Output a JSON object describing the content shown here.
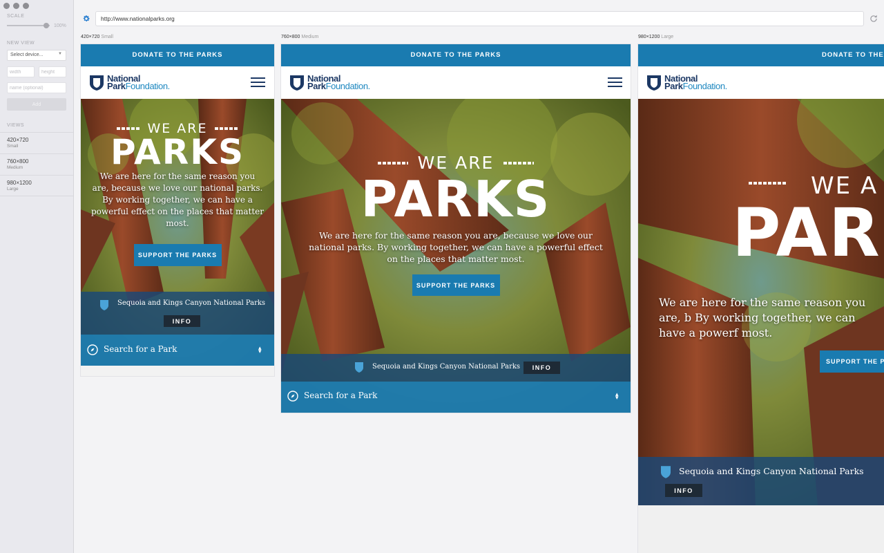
{
  "sidebar": {
    "scale_label": "SCALE",
    "scale_value": "100%",
    "new_view_label": "NEW VIEW",
    "device_select": "Select device...",
    "width_placeholder": "width",
    "height_placeholder": "height",
    "name_placeholder": "name (optional)",
    "add_label": "Add",
    "views_label": "VIEWS",
    "views": [
      {
        "size": "420×720",
        "name": "Small"
      },
      {
        "size": "760×800",
        "name": "Medium"
      },
      {
        "size": "980×1200",
        "name": "Large"
      }
    ]
  },
  "toolbar": {
    "url": "http://www.nationalparks.org"
  },
  "site": {
    "donate": "DONATE TO THE PARKS",
    "logo_line1": "National",
    "logo_line2a": "Park",
    "logo_line2b": "Foundation.",
    "we_are": "WE ARE",
    "parks": "PARKS",
    "tagline": "We are here for the same reason you are, because we love our national parks. By working together, we can have a powerful effect on the places that matter most.",
    "tagline_large": "We are here for the same reason you are, b By working together, we can have a powerf most.",
    "support": "SUPPORT THE PARKS",
    "support_large": "SUPPORT THE PA",
    "we_are_large": "WE A",
    "parks_large": "PAR",
    "park_name": "Sequoia and Kings Canyon National Parks",
    "info": "INFO",
    "search": "Search for a Park"
  },
  "frames": [
    {
      "size": "420×720",
      "name": "Small"
    },
    {
      "size": "760×800",
      "name": "Medium"
    },
    {
      "size": "980×1200",
      "name": "Large"
    }
  ],
  "colors": {
    "brand_blue": "#1a7bb0",
    "navy": "#1c3864",
    "accent": "#2a7fd0"
  }
}
